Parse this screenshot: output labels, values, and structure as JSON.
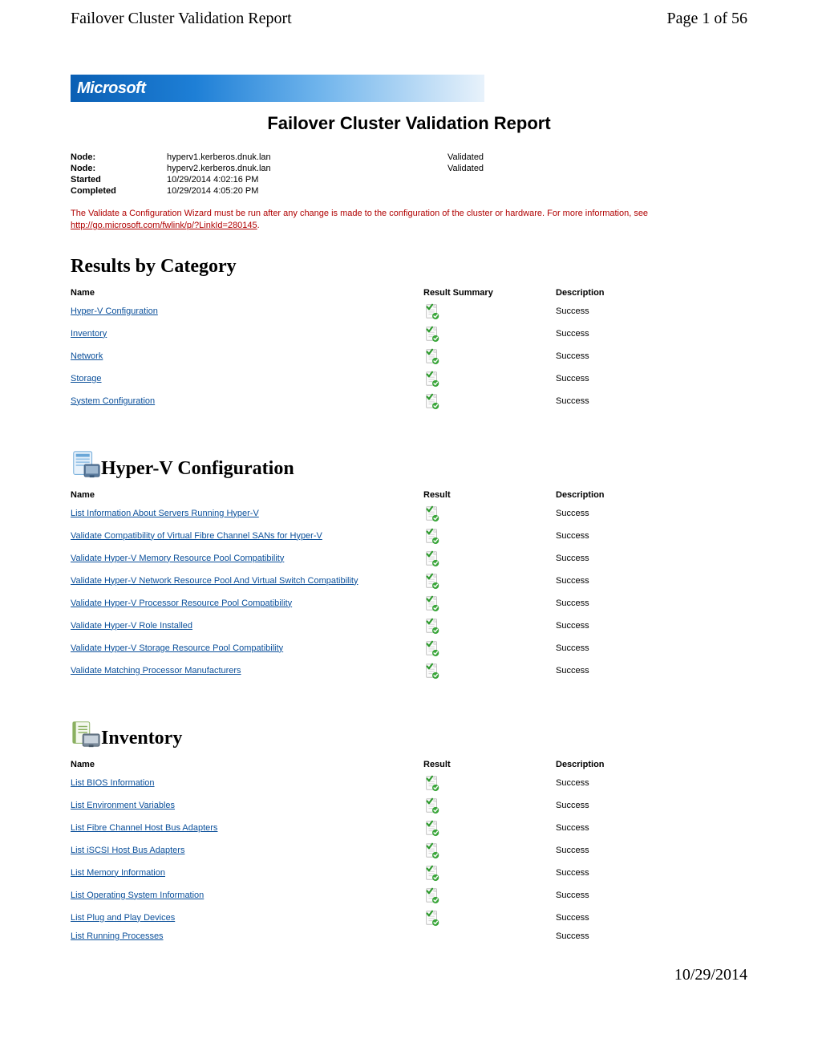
{
  "header": {
    "doc_title": "Failover Cluster Validation Report",
    "page_of": "Page 1 of 56"
  },
  "banner": {
    "brand": "Microsoft"
  },
  "report_title": "Failover Cluster Validation Report",
  "meta": {
    "rows": [
      {
        "label": "Node:",
        "value": "hyperv1.kerberos.dnuk.lan",
        "status": "Validated"
      },
      {
        "label": "Node:",
        "value": "hyperv2.kerberos.dnuk.lan",
        "status": "Validated"
      },
      {
        "label": "Started",
        "value": "10/29/2014 4:02:16 PM",
        "status": ""
      },
      {
        "label": "Completed",
        "value": "10/29/2014 4:05:20 PM",
        "status": ""
      }
    ]
  },
  "warning": {
    "text": "The Validate a Configuration Wizard must be run after any change is made to the configuration of the cluster or hardware. For more information, see ",
    "link_text": "http://go.microsoft.com/fwlink/p/?LinkId=280145",
    "suffix": "."
  },
  "categories_section": {
    "heading": "Results by Category",
    "columns": {
      "name": "Name",
      "result": "Result Summary",
      "desc": "Description"
    },
    "rows": [
      {
        "name": "Hyper-V Configuration",
        "desc": "Success"
      },
      {
        "name": "Inventory",
        "desc": "Success"
      },
      {
        "name": "Network",
        "desc": "Success"
      },
      {
        "name": "Storage",
        "desc": "Success"
      },
      {
        "name": "System Configuration",
        "desc": "Success"
      }
    ]
  },
  "hyperv_section": {
    "heading": "Hyper-V Configuration",
    "columns": {
      "name": "Name",
      "result": "Result",
      "desc": "Description"
    },
    "rows": [
      {
        "name": "List Information About Servers Running Hyper-V",
        "desc": "Success"
      },
      {
        "name": "Validate Compatibility of Virtual Fibre Channel SANs for Hyper-V",
        "desc": "Success"
      },
      {
        "name": "Validate Hyper-V Memory Resource Pool Compatibility",
        "desc": "Success"
      },
      {
        "name": "Validate Hyper-V Network Resource Pool And Virtual Switch Compatibility",
        "desc": "Success"
      },
      {
        "name": "Validate Hyper-V Processor Resource Pool Compatibility",
        "desc": "Success"
      },
      {
        "name": "Validate Hyper-V Role Installed",
        "desc": "Success"
      },
      {
        "name": "Validate Hyper-V Storage Resource Pool Compatibility",
        "desc": "Success"
      },
      {
        "name": "Validate Matching Processor Manufacturers",
        "desc": "Success"
      }
    ]
  },
  "inventory_section": {
    "heading": "Inventory",
    "columns": {
      "name": "Name",
      "result": "Result",
      "desc": "Description"
    },
    "rows": [
      {
        "name": "List BIOS Information",
        "desc": "Success"
      },
      {
        "name": "List Environment Variables",
        "desc": "Success"
      },
      {
        "name": "List Fibre Channel Host Bus Adapters",
        "desc": "Success"
      },
      {
        "name": "List iSCSI Host Bus Adapters",
        "desc": "Success"
      },
      {
        "name": "List Memory Information",
        "desc": "Success"
      },
      {
        "name": "List Operating System Information",
        "desc": "Success"
      },
      {
        "name": "List Plug and Play Devices",
        "desc": "Success"
      },
      {
        "name": "List Running Processes",
        "desc": "Success",
        "no_icon": true
      }
    ]
  },
  "footer": {
    "date": "10/29/2014"
  }
}
